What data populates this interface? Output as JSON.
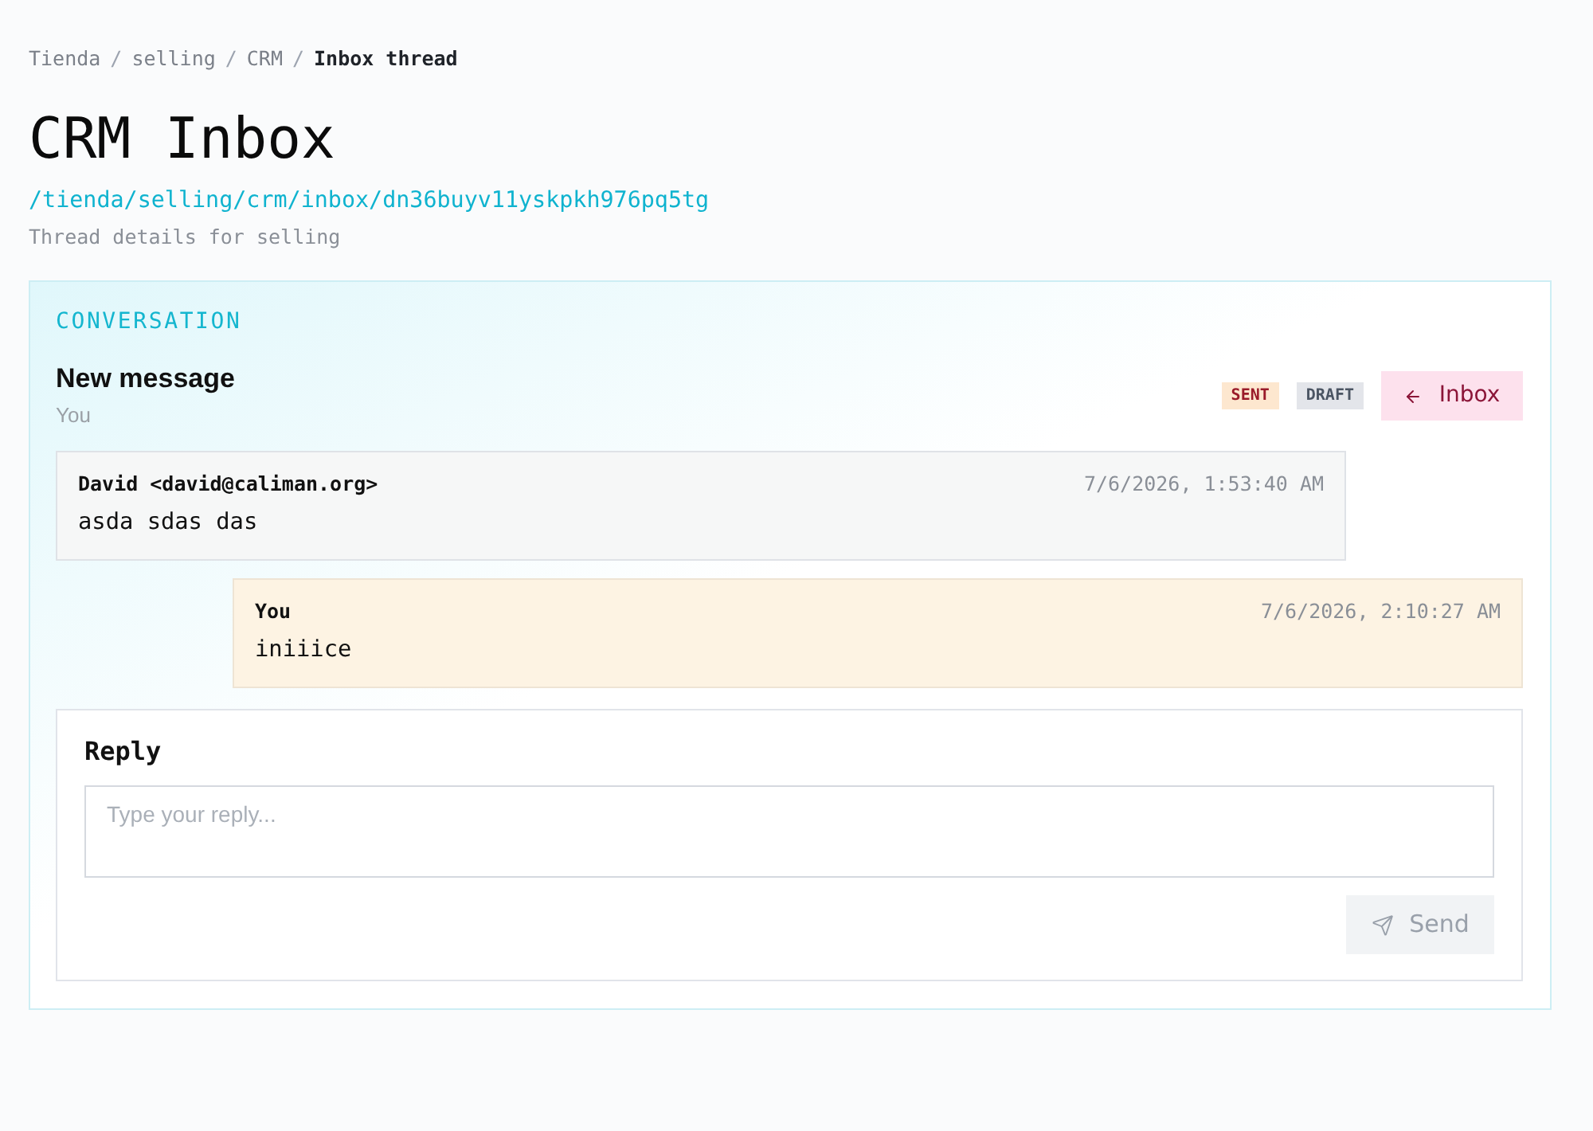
{
  "breadcrumb": {
    "separator": "/",
    "items": [
      {
        "label": "Tienda",
        "current": false
      },
      {
        "label": "selling",
        "current": false
      },
      {
        "label": "CRM",
        "current": false
      },
      {
        "label": "Inbox thread",
        "current": true
      }
    ]
  },
  "page": {
    "title": "CRM Inbox",
    "path": "/tienda/selling/crm/inbox/dn36buyv11yskpkh976pq5tg",
    "subtitle": "Thread details for selling"
  },
  "conversation": {
    "heading": "CONVERSATION",
    "subject": "New message",
    "participant": "You",
    "badges": [
      {
        "label": "SENT",
        "kind": "sent"
      },
      {
        "label": "DRAFT",
        "kind": "draft"
      }
    ],
    "back_button": {
      "label": "Inbox"
    },
    "messages": [
      {
        "kind": "incoming",
        "sender": "David <david@caliman.org>",
        "time": "7/6/2026, 1:53:40 AM",
        "body": "asda sdas das"
      },
      {
        "kind": "outgoing",
        "sender": "You",
        "time": "7/6/2026, 2:10:27 AM",
        "body": "iniiice"
      }
    ],
    "reply": {
      "heading": "Reply",
      "placeholder": "Type your reply...",
      "send_button": {
        "label": "Send",
        "disabled": true
      }
    }
  }
}
